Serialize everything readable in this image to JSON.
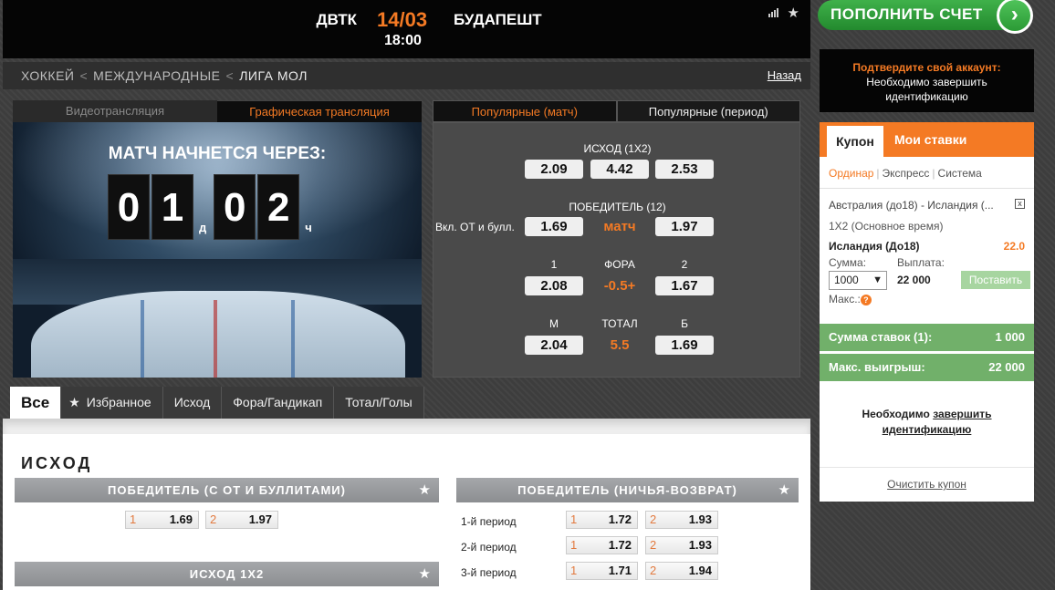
{
  "header": {
    "home_team": "ДВТК",
    "date": "14/03",
    "away_team": "БУДАПЕШТ",
    "time": "18:00",
    "icons": [
      "stats-icon",
      "star-icon"
    ]
  },
  "breadcrumb": {
    "items": [
      "ХОККЕЙ",
      "МЕЖДУНАРОДНЫЕ",
      "ЛИГА МОЛ"
    ],
    "separator": "<",
    "back": "Назад"
  },
  "video": {
    "tabs": [
      "Видеотрансляция",
      "Графическая трансляция"
    ],
    "active_tab": 1,
    "starts_in": "МАТЧ НАЧНЕТСЯ ЧЕРЕЗ:",
    "digits": [
      "0",
      "1",
      "0",
      "2"
    ],
    "units": [
      "д",
      "ч"
    ]
  },
  "popular": {
    "tabs": [
      "Популярные (матч)",
      "Популярные (период)"
    ],
    "active_tab": 0,
    "outcome_1x2": {
      "label": "ИСХОД (1X2)",
      "odds": [
        "2.09",
        "4.42",
        "2.53"
      ]
    },
    "winner_12": {
      "label": "ПОБЕДИТЕЛЬ (12)",
      "sublabel": "Вкл. ОТ и булл.",
      "odd1": "1.69",
      "middle": "матч",
      "odd2": "1.97"
    },
    "handicap": {
      "label1": "1",
      "label_mid": "ФОРА",
      "label2": "2",
      "odd1": "2.08",
      "value": "-0.5+",
      "odd2": "1.67"
    },
    "total": {
      "label1": "М",
      "label_mid": "ТОТАЛ",
      "label2": "Б",
      "odd1": "2.04",
      "value": "5.5",
      "odd2": "1.69"
    }
  },
  "market_tabs": [
    "Все",
    "Избранное",
    "Исход",
    "Фора/Гандикап",
    "Тотал/Голы"
  ],
  "content": {
    "section_title": "ИСХОД",
    "winner_ot": {
      "title": "ПОБЕДИТЕЛЬ (С ОТ И БУЛЛИТАМИ)",
      "odds": [
        {
          "i": "1",
          "v": "1.69"
        },
        {
          "i": "2",
          "v": "1.97"
        }
      ]
    },
    "outcome_1x2_title": "ИСХОД 1X2",
    "draw_no_bet": {
      "title": "ПОБЕДИТЕЛЬ (НИЧЬЯ-ВОЗВРАТ)",
      "rows": [
        {
          "period": "1-й период",
          "o1": "1.72",
          "o2": "1.93"
        },
        {
          "period": "2-й период",
          "o1": "1.72",
          "o2": "1.93"
        },
        {
          "period": "3-й период",
          "o1": "1.71",
          "o2": "1.94"
        }
      ],
      "idx1": "1",
      "idx2": "2"
    }
  },
  "sidebar": {
    "topup": "ПОПОЛНИТЬ СЧЕТ",
    "confirm_title": "Подтвердите свой аккаунт:",
    "confirm_text": "Необходимо завершить идентификацию",
    "coupon_tab": "Купон",
    "my_bets_tab": "Мои ставки",
    "types": [
      "Ординар",
      "Экспресс",
      "Система"
    ],
    "event": "Австралия (до18) - Исландия (...",
    "market": "1X2 (Основное время)",
    "selection": "Исландия (До18)",
    "selection_odd": "22.0",
    "sum_label": "Сумма:",
    "payout_label": "Выплата:",
    "amount": "1000",
    "payout": "22 000",
    "place_bet": "Поставить",
    "max_label": "Макс.:",
    "total_stakes_label": "Сумма ставок (1):",
    "total_stakes": "1 000",
    "max_win_label": "Макс. выигрыш:",
    "max_win": "22 000",
    "ident_text": "Необходимо",
    "ident_link1": "завершить",
    "ident_link2": "идентификацию",
    "clear": "Очистить купон"
  },
  "colors": {
    "accent": "#f47a24",
    "green": "#71b06a",
    "dark": "#050505"
  }
}
